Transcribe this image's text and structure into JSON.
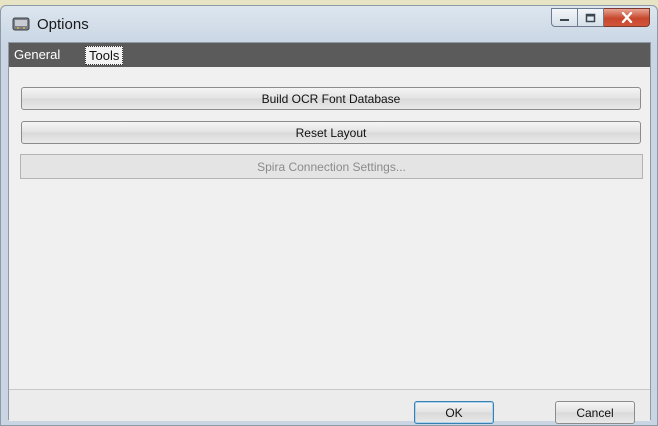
{
  "window": {
    "title": "Options",
    "controls": {
      "minimize": "minimize-icon",
      "maximize": "maximize-icon",
      "close": "close-icon"
    }
  },
  "tabs": [
    {
      "label": "General",
      "selected": false
    },
    {
      "label": "Tools",
      "selected": true
    }
  ],
  "tools": {
    "build_ocr_label": "Build OCR Font Database",
    "reset_layout_label": "Reset Layout",
    "spira_label": "Spira Connection Settings...",
    "spira_enabled": false
  },
  "footer": {
    "ok_label": "OK",
    "cancel_label": "Cancel"
  },
  "colors": {
    "tab_strip": "#5b5b5b",
    "client_bg": "#f0f0f0",
    "close_button": "#c7472d"
  }
}
